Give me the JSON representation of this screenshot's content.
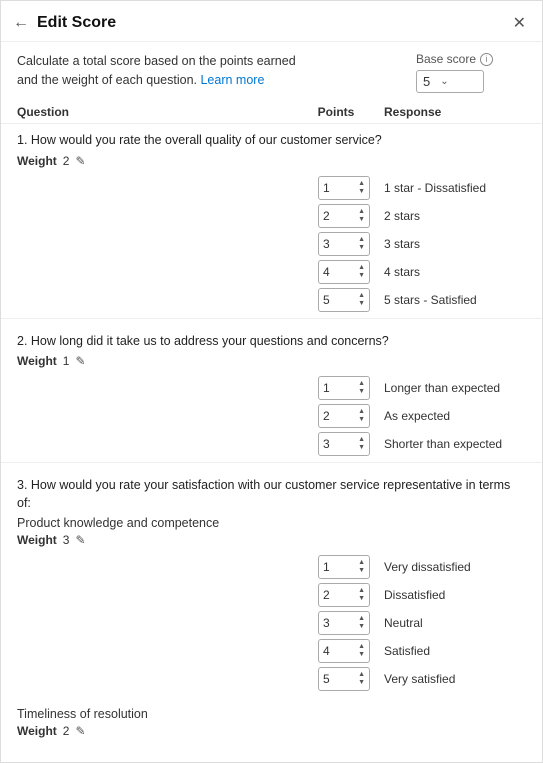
{
  "header": {
    "title": "Edit Score",
    "back_icon": "←",
    "close_icon": "✕"
  },
  "subheader": {
    "description": "Calculate a total score based on the points earned and the weight of each question.",
    "learn_more": "Learn more",
    "base_score": {
      "label": "Base score",
      "value": "5",
      "info_icon": "i"
    }
  },
  "table_headers": {
    "question": "Question",
    "points": "Points",
    "response": "Response"
  },
  "questions": [
    {
      "id": "q1",
      "text": "1. How would you rate the overall quality of our customer service?",
      "weight_label": "Weight",
      "weight_value": "2",
      "rows": [
        {
          "points": "1",
          "response": "1 star - Dissatisfied"
        },
        {
          "points": "2",
          "response": "2 stars"
        },
        {
          "points": "3",
          "response": "3 stars"
        },
        {
          "points": "4",
          "response": "4 stars"
        },
        {
          "points": "5",
          "response": "5 stars - Satisfied"
        }
      ]
    },
    {
      "id": "q2",
      "text": "2. How long did it take us to address your questions and concerns?",
      "weight_label": "Weight",
      "weight_value": "1",
      "rows": [
        {
          "points": "1",
          "response": "Longer than expected"
        },
        {
          "points": "2",
          "response": "As expected"
        },
        {
          "points": "3",
          "response": "Shorter than expected"
        }
      ]
    },
    {
      "id": "q3",
      "text": "3. How would you rate your satisfaction with our customer service representative in terms of:",
      "sub_questions": [
        {
          "label": "Product knowledge and competence",
          "weight_label": "Weight",
          "weight_value": "3",
          "rows": [
            {
              "points": "1",
              "response": "Very dissatisfied"
            },
            {
              "points": "2",
              "response": "Dissatisfied"
            },
            {
              "points": "3",
              "response": "Neutral"
            },
            {
              "points": "4",
              "response": "Satisfied"
            },
            {
              "points": "5",
              "response": "Very satisfied"
            }
          ]
        },
        {
          "label": "Timeliness of resolution",
          "weight_label": "Weight",
          "weight_value": "2"
        }
      ]
    }
  ]
}
